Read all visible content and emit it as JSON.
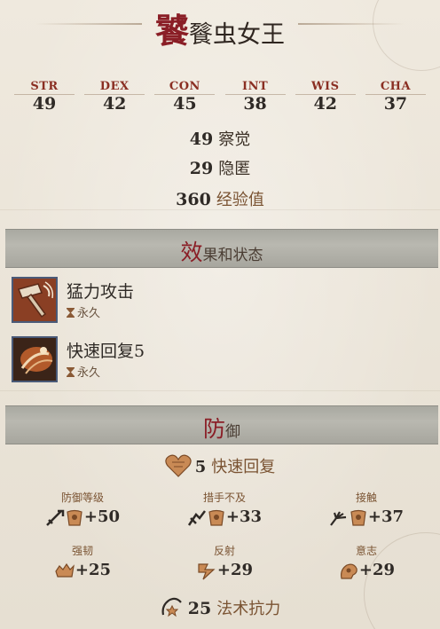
{
  "title": {
    "first_char": "饕",
    "rest": "餮虫女王"
  },
  "abilities": [
    {
      "name": "STR",
      "value": "49"
    },
    {
      "name": "DEX",
      "value": "42"
    },
    {
      "name": "CON",
      "value": "45"
    },
    {
      "name": "INT",
      "value": "38"
    },
    {
      "name": "WIS",
      "value": "42"
    },
    {
      "name": "CHA",
      "value": "37"
    }
  ],
  "perception": {
    "value": "49",
    "label": "察觉"
  },
  "stealth": {
    "value": "29",
    "label": "隐匿"
  },
  "experience": {
    "value": "360",
    "label": "经验值"
  },
  "effects_section": {
    "first_char": "效",
    "rest": "果和状态"
  },
  "effects": [
    {
      "name": "猛力攻击",
      "duration": "永久",
      "icon": "power-attack-hammer-icon"
    },
    {
      "name": "快速回复5",
      "duration": "永久",
      "icon": "fast-healing-icon"
    }
  ],
  "defense_section": {
    "first_char": "防",
    "rest": "御"
  },
  "fast_healing": {
    "value": "5",
    "label": "快速回复",
    "icon": "heart-icon"
  },
  "armor_class": [
    {
      "label": "防御等级",
      "value": "+50"
    },
    {
      "label": "措手不及",
      "value": "+33"
    },
    {
      "label": "接触",
      "value": "+37"
    }
  ],
  "saves": [
    {
      "label": "强韧",
      "value": "+25"
    },
    {
      "label": "反射",
      "value": "+29"
    },
    {
      "label": "意志",
      "value": "+29"
    }
  ],
  "spell_resistance": {
    "value": "25",
    "label": "法术抗力"
  },
  "colors": {
    "accent_red": "#8a1e26",
    "label_brown": "#7a5332",
    "header_gray": "#b2b1a9",
    "icon_orange": "#c0703a"
  }
}
